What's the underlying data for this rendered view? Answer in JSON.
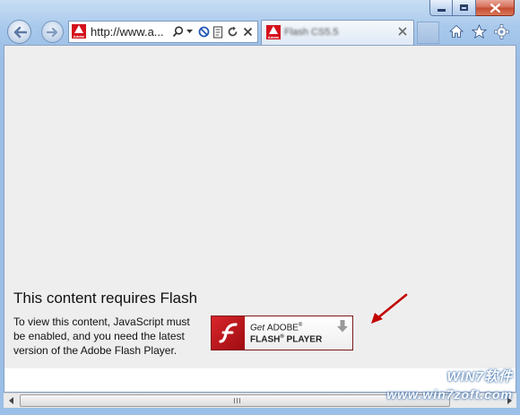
{
  "browser": {
    "address_url": "http://www.a...",
    "tab_title": "Flash CS5.5",
    "favicon_text": "Adobe"
  },
  "flash_notice": {
    "title": "This content requires Flash",
    "description": "To view this content, JavaScript must be enabled, and you need the latest version of the Adobe Flash Player.",
    "get_button": {
      "line1_prefix": "Get ",
      "line1_brand": "ADOBE",
      "line2": "FLASH",
      "line2_suffix": " PLAYER"
    }
  },
  "watermark": {
    "line1": "WIN7软件",
    "line2": "www.win7zoft.com"
  },
  "colors": {
    "adobe_red": "#d4111b",
    "annotation_arrow": "#c00000",
    "content_bg": "#efeeee"
  },
  "icons": [
    "back-arrow-icon",
    "forward-arrow-icon",
    "search-icon",
    "dropdown-icon",
    "blocked-icon",
    "compat-view-icon",
    "refresh-icon",
    "stop-icon",
    "tab-close-icon",
    "home-icon",
    "favorites-icon",
    "tools-gear-icon",
    "flash-logo-icon",
    "download-arrow-icon"
  ]
}
